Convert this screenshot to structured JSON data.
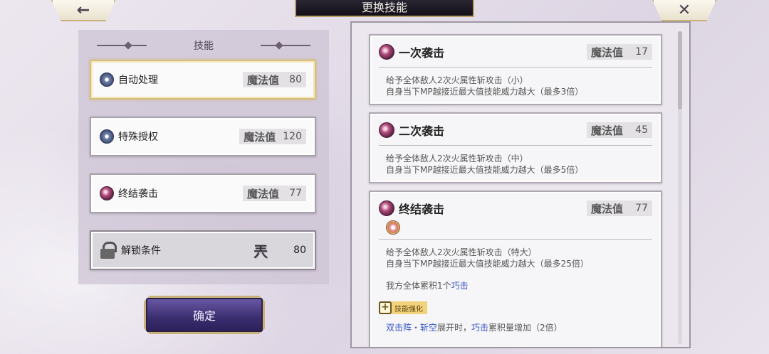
{
  "header": {
    "title": "更换技能",
    "back_icon": "←",
    "close_icon": "✕"
  },
  "left_panel": {
    "heading": "技能",
    "slots": [
      {
        "name": "自动处理",
        "mp_label": "魔法值",
        "mp": "80",
        "icon": "gear-icon"
      },
      {
        "name": "特殊授权",
        "mp_label": "魔法值",
        "mp": "120",
        "icon": "gear-icon"
      },
      {
        "name": "终结袭击",
        "mp_label": "魔法值",
        "mp": "77",
        "icon": "slash-icon"
      }
    ],
    "unlock": {
      "label": "解锁条件",
      "glyph": "兲",
      "value": "80"
    }
  },
  "confirm_label": "确定",
  "skill_cards": [
    {
      "title": "一次袭击",
      "mp_label": "魔法值",
      "mp": "17",
      "desc1": "给予全体敌人2次火属性斩攻击（小）",
      "desc2": "自身当下MP越接近最大值技能威力越大（最多3倍）"
    },
    {
      "title": "二次袭击",
      "mp_label": "魔法值",
      "mp": "45",
      "desc1": "给予全体敌人2次火属性斩攻击（中）",
      "desc2": "自身当下MP越接近最大值技能威力越大（最多5倍）"
    },
    {
      "title": "终结袭击",
      "mp_label": "魔法值",
      "mp": "77",
      "desc1": "给予全体敌人2次火属性斩攻击（特大）",
      "desc2": "自身当下MP越接近最大值技能威力越大（最多25倍）",
      "extra_prefix": "我方全体累积1个",
      "extra_link": "巧击",
      "enhance_label": "技能强化",
      "bottom_link1": "双击阵・斩空",
      "bottom_mid": "展开时，",
      "bottom_link2": "巧击",
      "bottom_tail": "累积量增加（2倍）"
    }
  ],
  "colors": {
    "accent_gold": "#c9b27a",
    "confirm_purple": "#3a2d6e",
    "link_blue": "#3a58c8"
  }
}
